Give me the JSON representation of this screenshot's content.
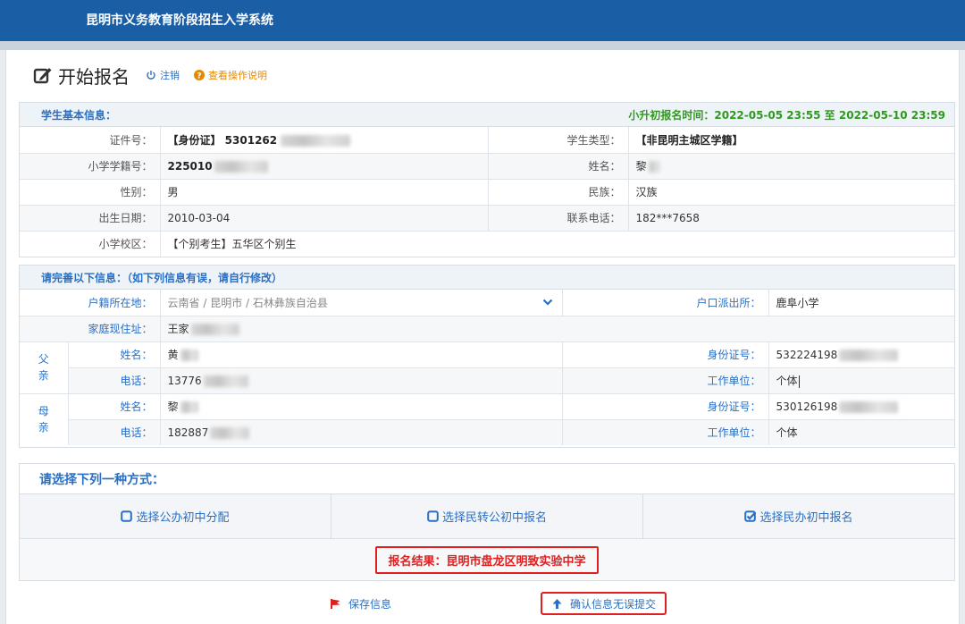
{
  "app": {
    "title": "昆明市义务教育阶段招生入学系统"
  },
  "header": {
    "title": "开始报名",
    "logout": "注销",
    "help": "查看操作说明"
  },
  "student": {
    "section_title": "学生基本信息：",
    "period_label": "小升初报名时间：",
    "period_value": "2022-05-05 23:55 至 2022-05-10 23:59",
    "id_label": "证件号：",
    "id_value": "【身份证】 5301262",
    "type_label": "学生类型：",
    "type_value": "【非昆明主城区学籍】",
    "roll_label": "小学学籍号：",
    "roll_value": "225010",
    "name_label": "姓名：",
    "name_value": "黎",
    "gender_label": "性别：",
    "gender_value": "男",
    "nation_label": "民族：",
    "nation_value": "汉族",
    "birth_label": "出生日期：",
    "birth_value": "2010-03-04",
    "phone_label": "联系电话：",
    "phone_value": "182***7658",
    "school_label": "小学校区：",
    "school_value": "【个别考生】五华区个别生"
  },
  "complete": {
    "section_title": "请完善以下信息：（如下列信息有误，请自行修改）",
    "huji_label": "户籍所在地：",
    "huji_value": "云南省 /  昆明市 /  石林彝族自治县",
    "police_label": "户口派出所：",
    "police_value": "鹿阜小学",
    "address_label": "家庭现住址：",
    "address_value": "王家",
    "father_label_1": "父",
    "father_label_2": "亲",
    "mother_label_1": "母",
    "mother_label_2": "亲",
    "name_label": "姓名：",
    "phone_label": "电话：",
    "idno_label": "身份证号：",
    "work_label": "工作单位：",
    "father_name": "黄",
    "father_phone": "13776",
    "father_id": "532224198",
    "father_work": "个体",
    "mother_name": "黎",
    "mother_phone": "182887",
    "mother_id": "530126198",
    "mother_work": "个体"
  },
  "choose": {
    "title": "请选择下列一种方式：",
    "options": [
      "选择公办初中分配",
      "选择民转公初中报名",
      "选择民办初中报名"
    ],
    "checked_index": 2,
    "result": "报名结果：昆明市盘龙区明致实验中学"
  },
  "actions": {
    "save": "保存信息",
    "submit": "确认信息无误提交"
  },
  "colors": {
    "brand": "#1a5ea6",
    "link": "#2a6fc4",
    "accent_red": "#e02020",
    "time_green": "#2f9a1d"
  }
}
